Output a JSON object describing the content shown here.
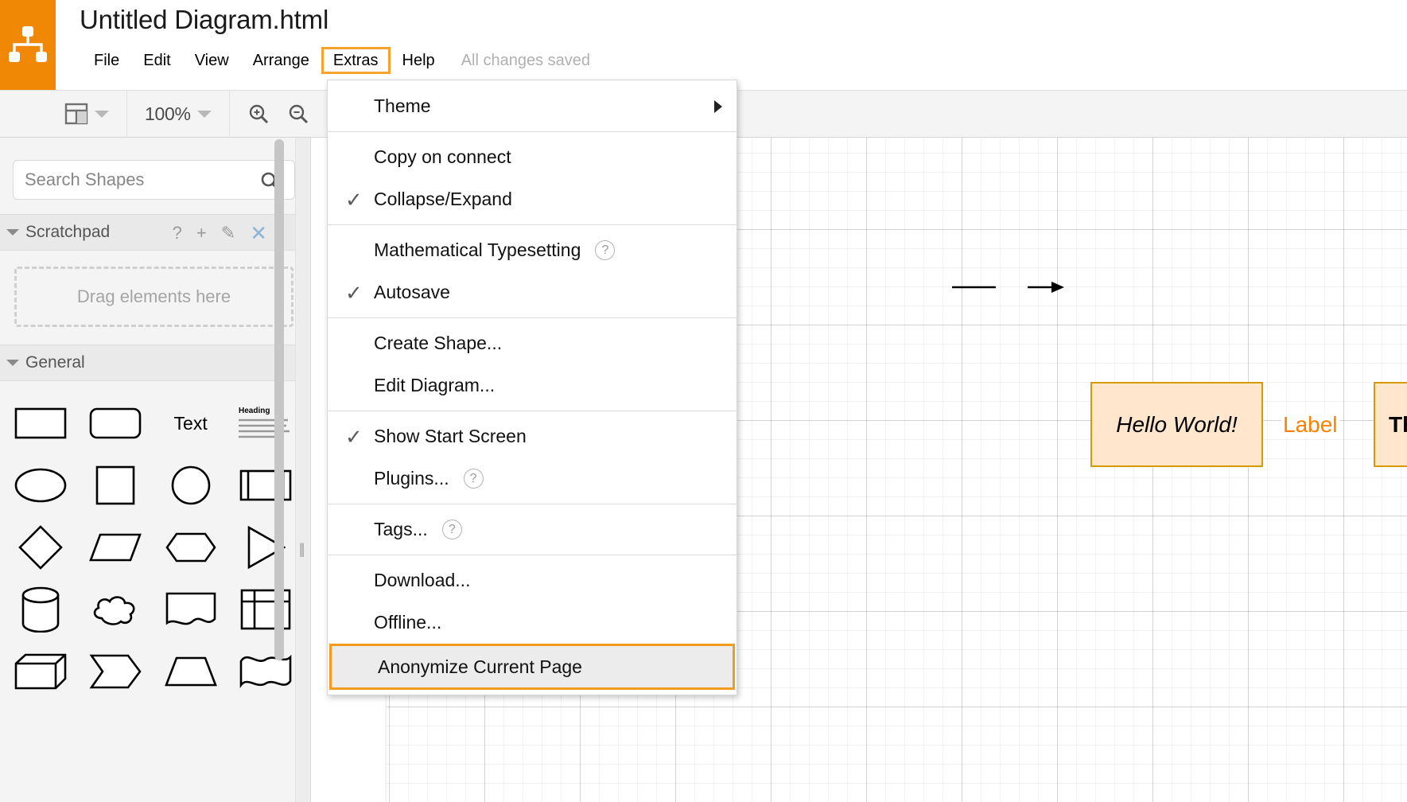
{
  "app": {
    "logo_icon": "drawio-logo-icon",
    "brand_color": "#f08705",
    "accent_color": "#f7a32b"
  },
  "header": {
    "document_title": "Untitled Diagram.html",
    "menus": [
      {
        "label": "File",
        "active": false
      },
      {
        "label": "Edit",
        "active": false
      },
      {
        "label": "View",
        "active": false
      },
      {
        "label": "Arrange",
        "active": false
      },
      {
        "label": "Extras",
        "active": true
      },
      {
        "label": "Help",
        "active": false
      }
    ],
    "save_status": "All changes saved"
  },
  "toolbar": {
    "view_layout_icon": "panel-layout-icon",
    "zoom_level": "100%",
    "zoom_in_icon": "zoom-in-icon",
    "zoom_out_icon": "zoom-out-icon",
    "fit_page_icon": "fit-page-icon",
    "waypoints_icon": "waypoints-icon",
    "connection_arrow_icon": "connection-arrow-icon",
    "connection_style_icon": "connection-style-icon",
    "insert_icon": "plus-icon"
  },
  "sidebar": {
    "search": {
      "placeholder": "Search Shapes",
      "value": "",
      "icon": "search-icon"
    },
    "scratchpad": {
      "title": "Scratchpad",
      "dropzone_text": "Drag elements here",
      "actions": [
        {
          "name": "help",
          "glyph": "?"
        },
        {
          "name": "add",
          "glyph": "+"
        },
        {
          "name": "edit",
          "glyph": "✎"
        },
        {
          "name": "close",
          "glyph": "✕"
        }
      ]
    },
    "general": {
      "title": "General",
      "shapes": [
        {
          "name": "rectangle",
          "type": "rect"
        },
        {
          "name": "rounded-rectangle",
          "type": "rounded"
        },
        {
          "name": "text",
          "type": "text",
          "label": "Text"
        },
        {
          "name": "textbox",
          "type": "textbox",
          "heading": "Heading",
          "body": "Lorem ipsum dolor sit amet, consectetur adipiscing elit, sed do eiusmod tempor incididunt ut labore et dolore magna aliqua."
        },
        {
          "name": "ellipse",
          "type": "ellipse"
        },
        {
          "name": "square",
          "type": "square"
        },
        {
          "name": "circle",
          "type": "circle"
        },
        {
          "name": "process",
          "type": "process"
        },
        {
          "name": "diamond",
          "type": "diamond"
        },
        {
          "name": "parallelogram",
          "type": "parallelogram"
        },
        {
          "name": "hexagon",
          "type": "hexagon"
        },
        {
          "name": "triangle",
          "type": "triangle"
        },
        {
          "name": "cylinder",
          "type": "cylinder"
        },
        {
          "name": "cloud",
          "type": "cloud"
        },
        {
          "name": "document",
          "type": "document"
        },
        {
          "name": "table",
          "type": "table"
        },
        {
          "name": "cube",
          "type": "cube"
        },
        {
          "name": "step",
          "type": "step"
        },
        {
          "name": "trapezoid",
          "type": "trapezoid"
        },
        {
          "name": "tape",
          "type": "tape"
        }
      ]
    }
  },
  "extras_menu": {
    "items": [
      {
        "label": "Theme",
        "checked": false,
        "submenu": true,
        "help": false,
        "highlight": false,
        "sep_after": true
      },
      {
        "label": "Copy on connect",
        "checked": false,
        "submenu": false,
        "help": false,
        "highlight": false,
        "sep_after": false
      },
      {
        "label": "Collapse/Expand",
        "checked": true,
        "submenu": false,
        "help": false,
        "highlight": false,
        "sep_after": true
      },
      {
        "label": "Mathematical Typesetting",
        "checked": false,
        "submenu": false,
        "help": true,
        "highlight": false,
        "sep_after": false
      },
      {
        "label": "Autosave",
        "checked": true,
        "submenu": false,
        "help": false,
        "highlight": false,
        "sep_after": true
      },
      {
        "label": "Create Shape...",
        "checked": false,
        "submenu": false,
        "help": false,
        "highlight": false,
        "sep_after": false
      },
      {
        "label": "Edit Diagram...",
        "checked": false,
        "submenu": false,
        "help": false,
        "highlight": false,
        "sep_after": true
      },
      {
        "label": "Show Start Screen",
        "checked": true,
        "submenu": false,
        "help": false,
        "highlight": false,
        "sep_after": false
      },
      {
        "label": "Plugins...",
        "checked": false,
        "submenu": false,
        "help": true,
        "highlight": false,
        "sep_after": true
      },
      {
        "label": "Tags...",
        "checked": false,
        "submenu": false,
        "help": true,
        "highlight": false,
        "sep_after": true
      },
      {
        "label": "Download...",
        "checked": false,
        "submenu": false,
        "help": false,
        "highlight": false,
        "sep_after": false
      },
      {
        "label": "Offline...",
        "checked": false,
        "submenu": false,
        "help": false,
        "highlight": false,
        "sep_after": false
      },
      {
        "label": "Anonymize Current Page",
        "checked": false,
        "submenu": false,
        "help": false,
        "highlight": true,
        "sep_after": false
      }
    ]
  },
  "canvas": {
    "nodes": [
      {
        "id": "n1",
        "text": "Hello World!",
        "fill": "#ffe6cc",
        "stroke": "#d79b00",
        "style": "italic"
      },
      {
        "id": "n2",
        "text": "This is a test!",
        "fill": "#ffe6cc",
        "stroke": "#d79b00",
        "style": "bold"
      }
    ],
    "edges": [
      {
        "from": "n1",
        "to": "n2",
        "label": "Label",
        "label_color": "#ff8000"
      }
    ],
    "grid_visible": true
  }
}
